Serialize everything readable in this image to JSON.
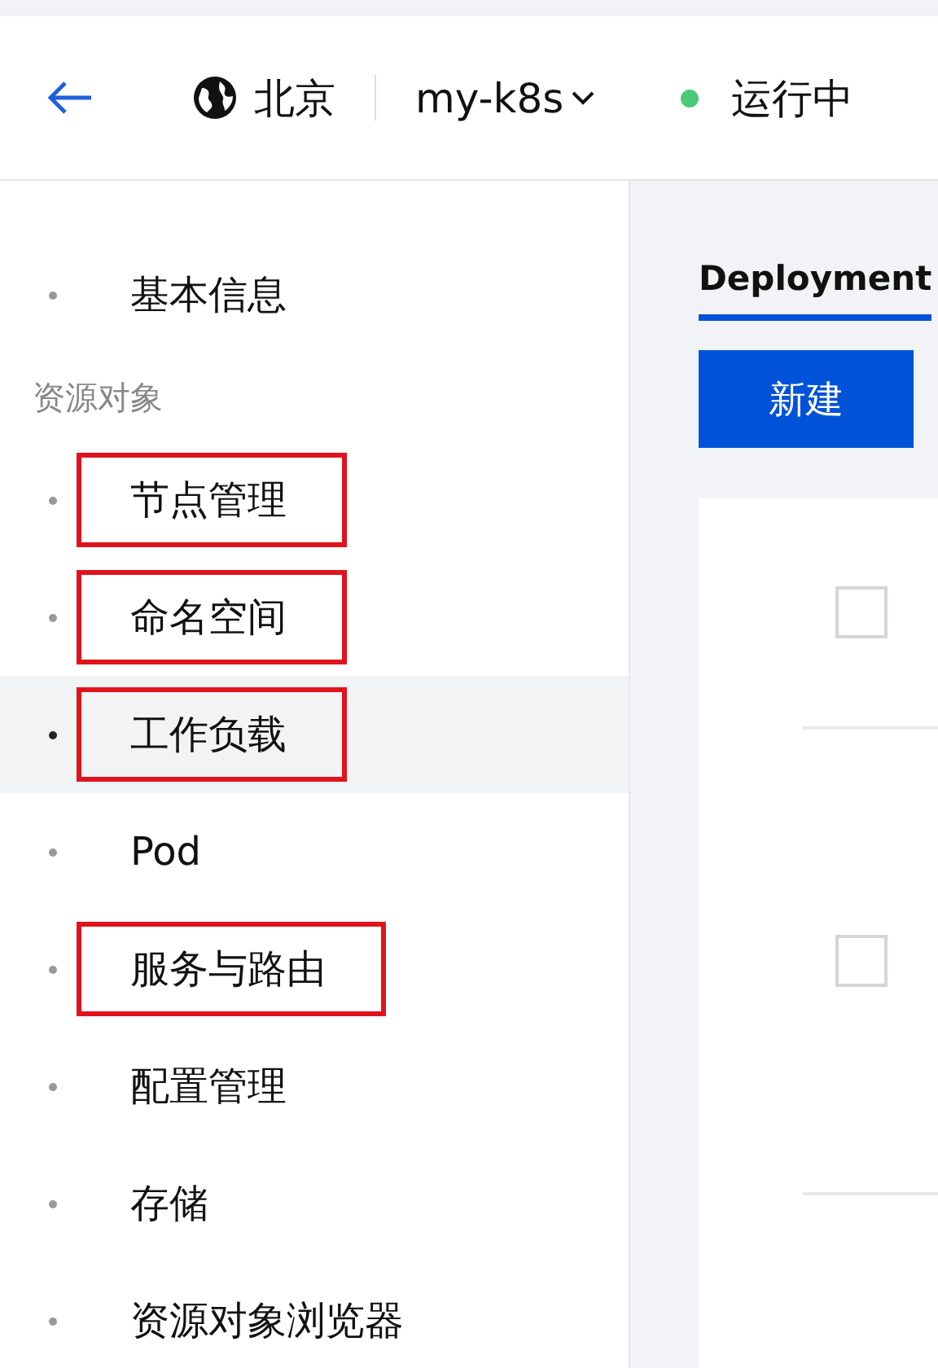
{
  "header": {
    "region": "北京",
    "cluster": "my-k8s",
    "status": "运行中"
  },
  "sidebar": {
    "items": [
      {
        "kind": "item",
        "label": "基本信息",
        "selected": false,
        "annotated": false
      },
      {
        "kind": "section",
        "label": "资源对象"
      },
      {
        "kind": "item",
        "label": "节点管理",
        "selected": false,
        "annotated": true
      },
      {
        "kind": "item",
        "label": "命名空间",
        "selected": false,
        "annotated": true
      },
      {
        "kind": "item",
        "label": "工作负载",
        "selected": true,
        "annotated": true
      },
      {
        "kind": "item",
        "label": "Pod",
        "selected": false,
        "annotated": false
      },
      {
        "kind": "item",
        "label": "服务与路由",
        "selected": false,
        "annotated": true
      },
      {
        "kind": "item",
        "label": "配置管理",
        "selected": false,
        "annotated": false
      },
      {
        "kind": "item",
        "label": "存储",
        "selected": false,
        "annotated": false
      },
      {
        "kind": "item",
        "label": "资源对象浏览器",
        "selected": false,
        "annotated": false
      }
    ]
  },
  "tabs": [
    {
      "label": "Deployment",
      "selected": true
    }
  ],
  "create_button": "新建",
  "table": {
    "rows": [
      {
        "checked": false
      },
      {
        "checked": false
      }
    ]
  }
}
